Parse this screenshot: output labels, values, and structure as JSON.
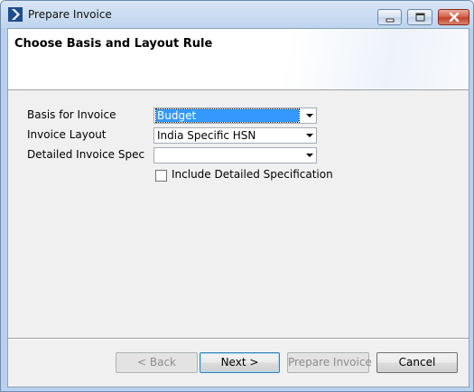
{
  "window": {
    "title": "Prepare Invoice",
    "icon": "app-chevron-icon"
  },
  "header": {
    "title": "Choose Basis and Layout Rule"
  },
  "form": {
    "basis": {
      "label": "Basis for Invoice",
      "value": "Budget"
    },
    "layout": {
      "label": "Invoice Layout",
      "value": "India Specific HSN"
    },
    "detailed": {
      "label": "Detailed Invoice Specifi...",
      "value": ""
    },
    "include_detailed": {
      "label": "Include Detailed Specification",
      "checked": false
    }
  },
  "buttons": {
    "back": "< Back",
    "next": "Next >",
    "prepare": "Prepare Invoice",
    "cancel": "Cancel"
  },
  "colors": {
    "selection": "#3399ff",
    "title_bar": "#bfd5ee"
  }
}
